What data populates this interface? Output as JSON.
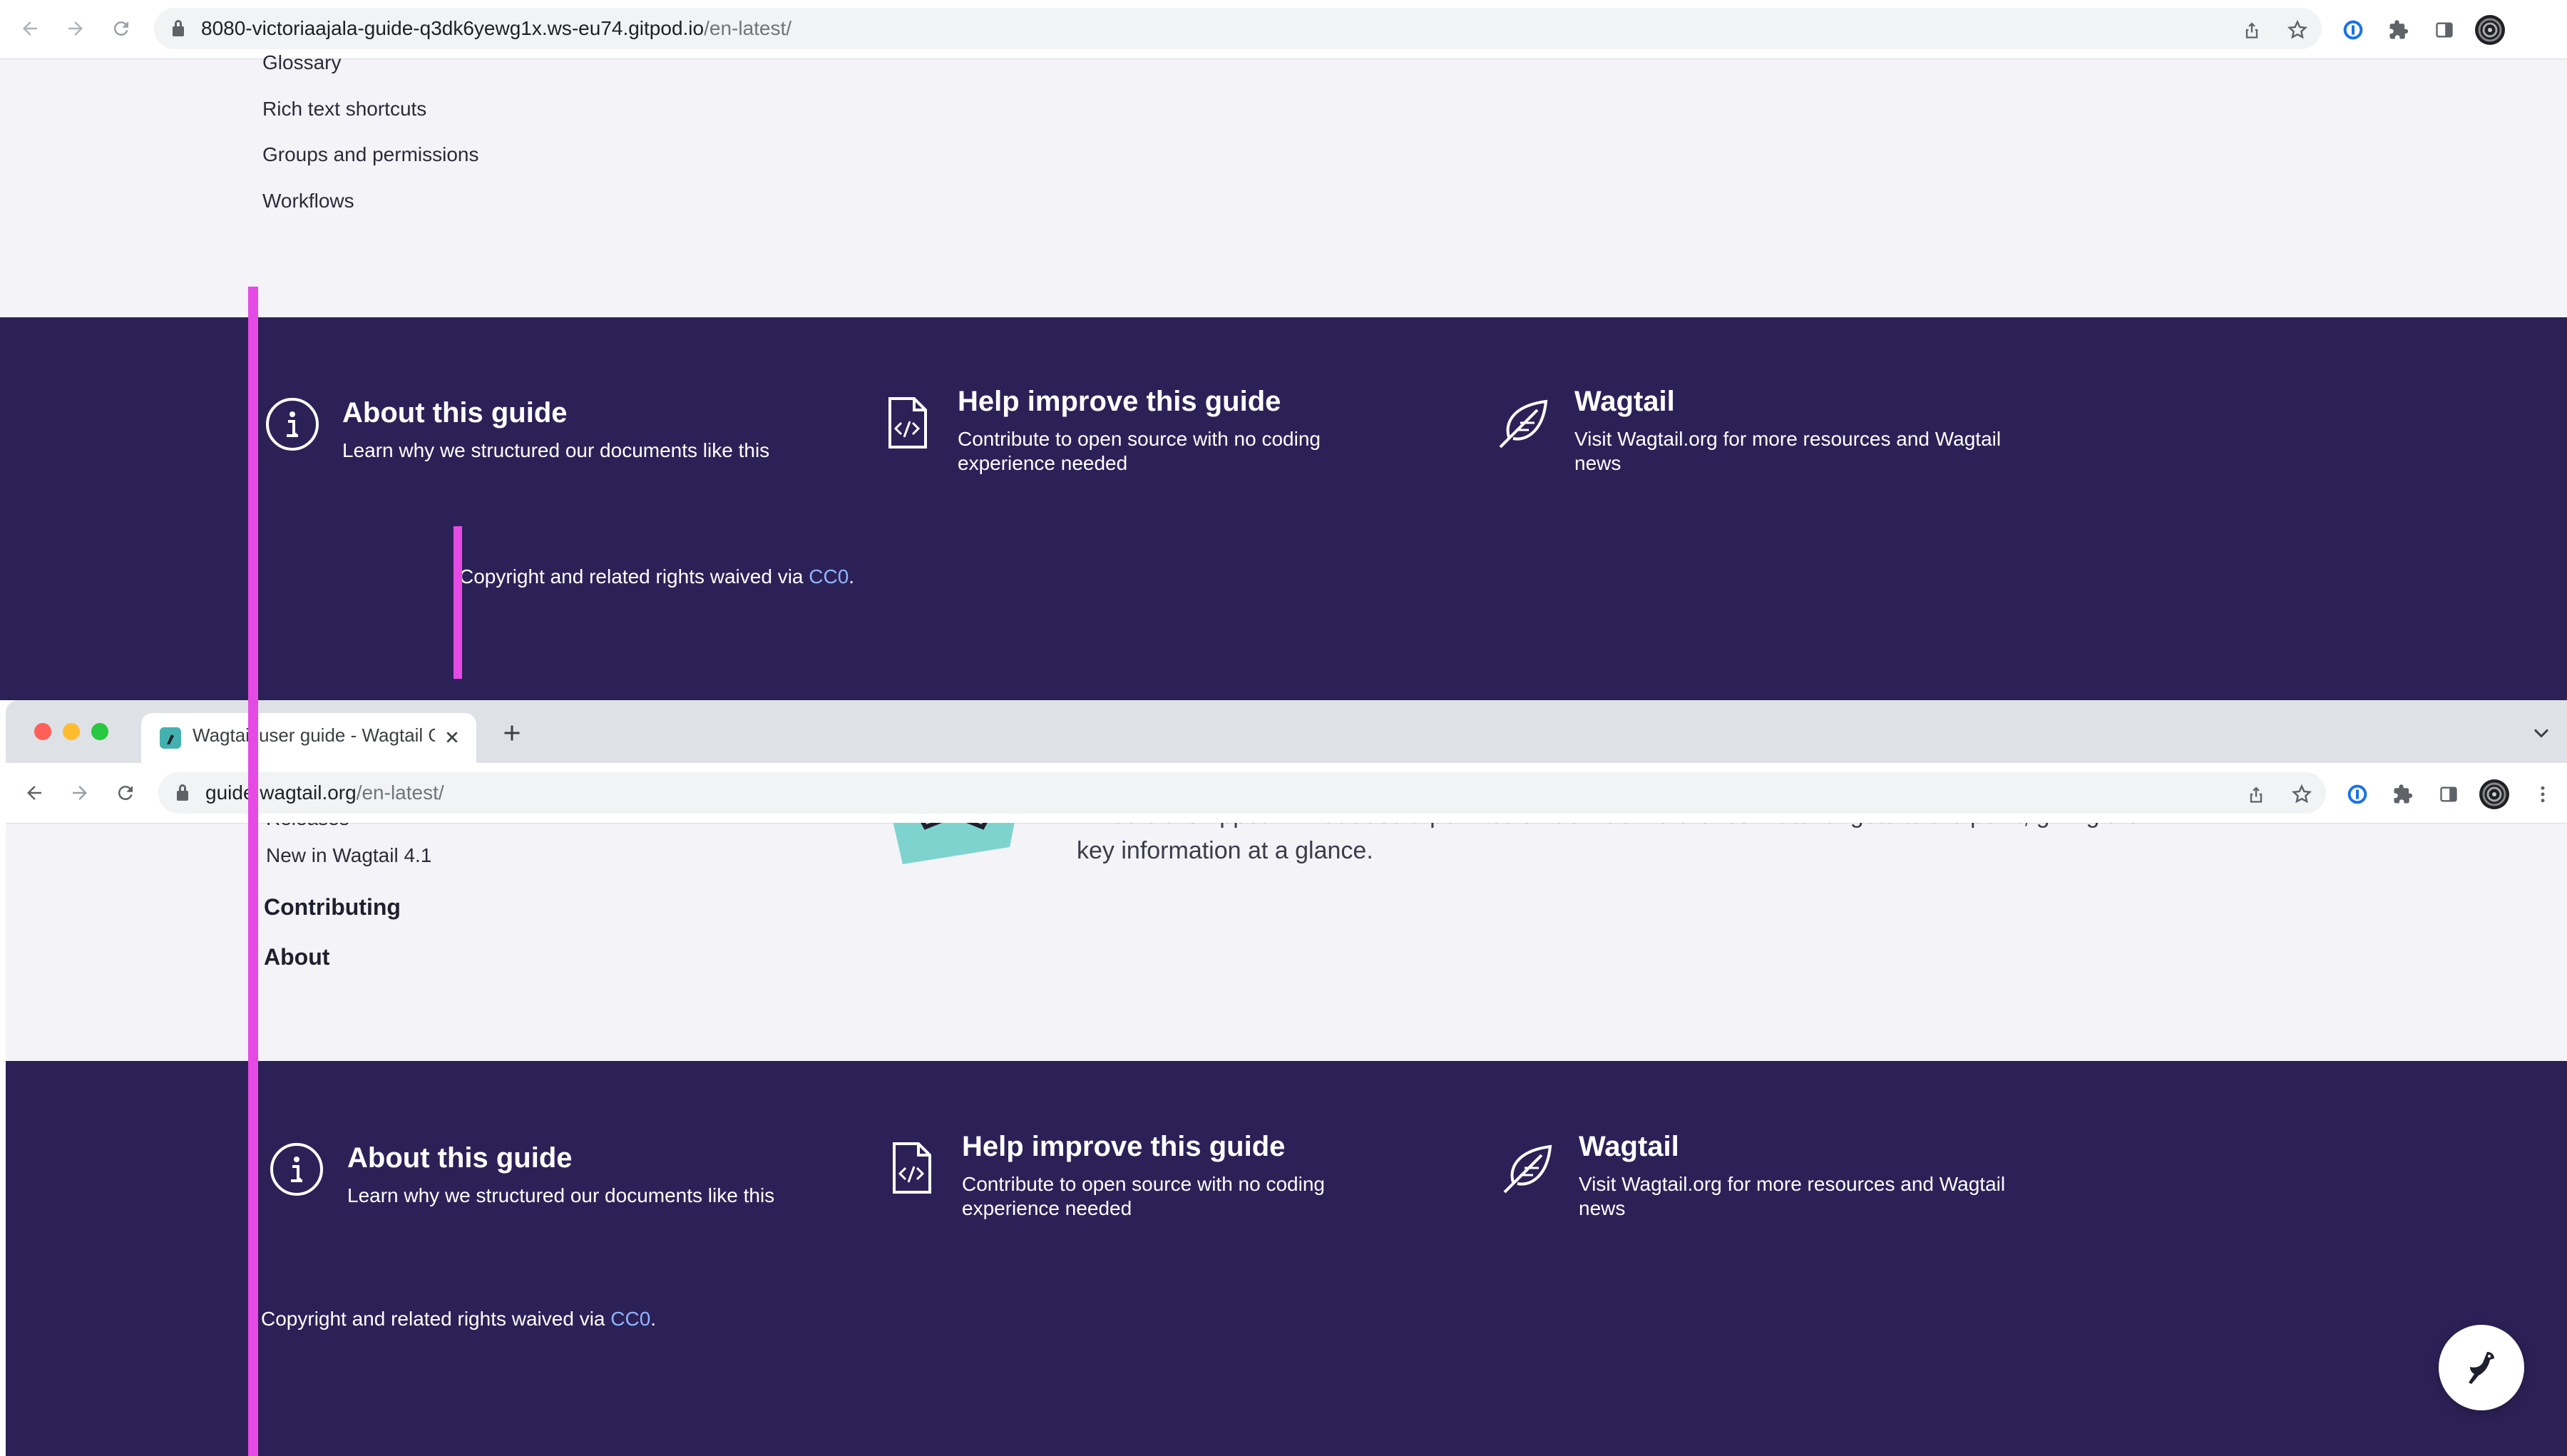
{
  "top_window": {
    "url_host": "8080-victoriaajala-guide-q3dk6yewg1x.ws-eu74.gitpod.io",
    "url_path": "/en-latest/",
    "sidebar_links": [
      "Glossary",
      "Rich text shortcuts",
      "Groups and permissions",
      "Workflows"
    ],
    "footer": {
      "about_title": "About this guide",
      "about_sub": "Learn why we structured our documents like this",
      "help_title": "Help improve this guide",
      "help_sub": "Contribute to open source with no coding experience needed",
      "wagtail_title": "Wagtail",
      "wagtail_sub": "Visit Wagtail.org for more resources and Wagtail news",
      "copyright_prefix": "Copyright and related rights waived via ",
      "copyright_link": "CC0",
      "copyright_suffix": "."
    }
  },
  "bottom_window": {
    "tab_title": "Wagtail user guide - Wagtail Guide",
    "url_host": "guide.wagtail.org",
    "url_path": "/en-latest/",
    "sidebar": {
      "partial_link": "Releases",
      "new_link": "New in Wagtail 4.1",
      "heading_contributing": "Contributing",
      "heading_about": "About"
    },
    "intro_text": "What is a Snippet? What does a permission do? Our reference material gets to the point, giving the key information at a glance.",
    "footer": {
      "about_title": "About this guide",
      "about_sub": "Learn why we structured our documents like this",
      "help_title": "Help improve this guide",
      "help_sub": "Contribute to open source with no coding experience needed",
      "wagtail_title": "Wagtail",
      "wagtail_sub": "Visit Wagtail.org for more resources and Wagtail news",
      "copyright_prefix": "Copyright and related rights waived via ",
      "copyright_link": "CC0",
      "copyright_suffix": "."
    }
  },
  "colors": {
    "footer_bg": "#2c2157",
    "page_bg": "#f4f3f7",
    "link_color": "#8fb5ff",
    "marker_line": "#e54ae5"
  },
  "icons": [
    "back-arrow-icon",
    "forward-arrow-icon",
    "reload-icon",
    "share-icon",
    "star-icon",
    "password-manager-icon",
    "extensions-icon",
    "side-panel-icon",
    "profile-avatar-icon",
    "kebab-menu-icon",
    "info-icon",
    "code-file-icon",
    "feather-icon",
    "wagtail-bird-icon",
    "new-tab-icon",
    "tab-close-icon",
    "tab-list-icon"
  ]
}
